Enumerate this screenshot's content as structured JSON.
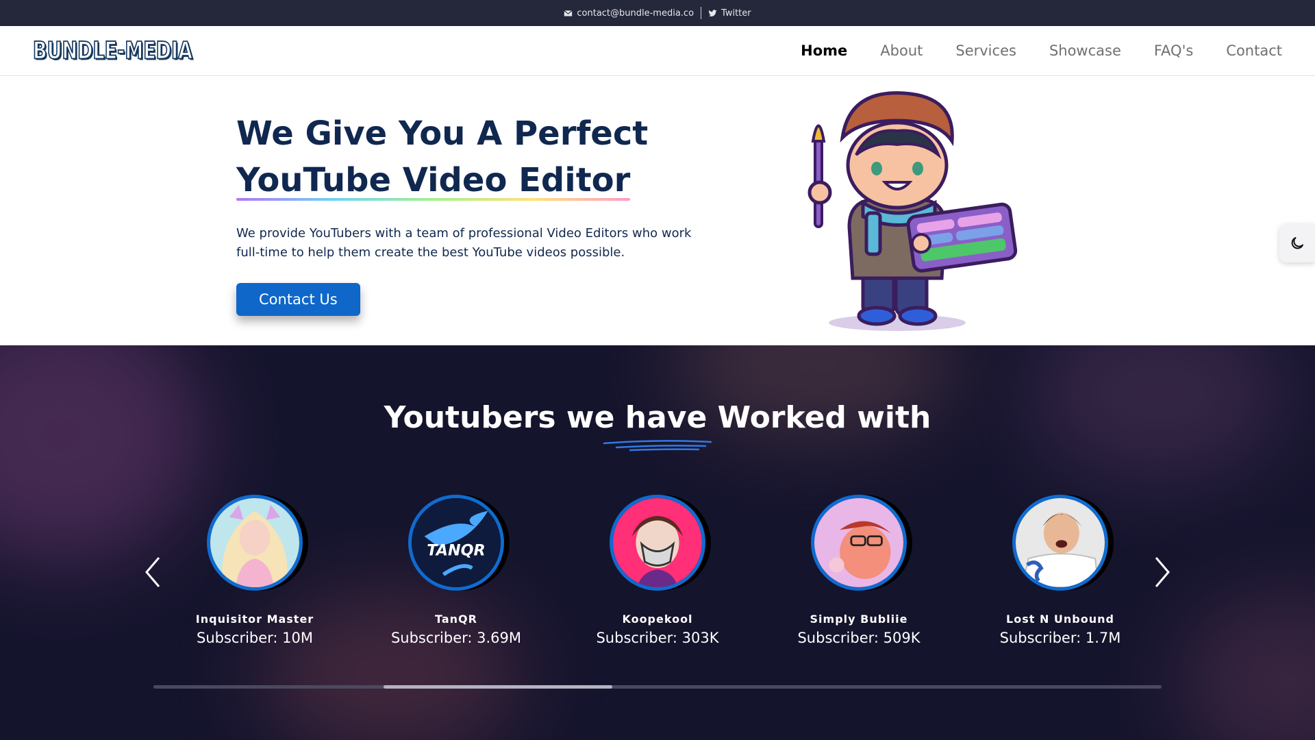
{
  "topbar": {
    "email": "contact@bundle-media.co",
    "twitter": "Twitter"
  },
  "nav": {
    "logo": "BUNDLE-MEDIA",
    "links": [
      "Home",
      "About",
      "Services",
      "Showcase",
      "FAQ's",
      "Contact"
    ],
    "active": "Home"
  },
  "hero": {
    "title_line1": "We Give You A Perfect",
    "title_line2": "YouTube Video Editor",
    "description": "We provide YouTubers with a team of professional Video Editors who work full-time to help them create the best YouTube videos possible.",
    "cta": "Contact Us"
  },
  "creators": {
    "title": "Youtubers we have Worked with",
    "items": [
      {
        "name": "Inquisitor Master",
        "subscribers": "Subscriber: 10M"
      },
      {
        "name": "TanQR",
        "subscribers": "Subscriber: 3.69M"
      },
      {
        "name": "Koopekool",
        "subscribers": "Subscriber: 303K"
      },
      {
        "name": "Simply Bubliie",
        "subscribers": "Subscriber: 509K"
      },
      {
        "name": "Lost N Unbound",
        "subscribers": "Subscriber: 1.7M"
      }
    ],
    "tanqr_logo_text": "TANQR"
  },
  "icons": {
    "email": "envelope-icon",
    "twitter": "twitter-icon",
    "dark_mode": "moon-icon",
    "prev": "chevron-left-icon",
    "next": "chevron-right-icon"
  },
  "colors": {
    "topbar_bg": "#25273a",
    "primary": "#0f67c9",
    "heading": "#10284f",
    "section_bg": "#15142d"
  }
}
